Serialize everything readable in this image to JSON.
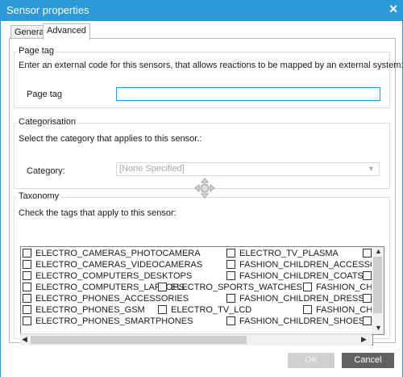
{
  "window": {
    "title": "Sensor properties"
  },
  "tabs": [
    {
      "label": "General"
    },
    {
      "label": "Advanced"
    }
  ],
  "page_tag": {
    "legend": "Page tag",
    "description": "Enter an external code for this sensors, that allows reactions to be mapped by an external system:",
    "label": "Page tag",
    "value": ""
  },
  "categorisation": {
    "legend": "Categorisation",
    "description": "Select the category that applies to this sensor.:",
    "label": "Category:",
    "selected": "[None Specified]"
  },
  "taxonomy": {
    "legend": "Taxonomy",
    "description": "Check the tags that apply to this sensor:",
    "tags": {
      "c1": [
        "ELECTRO_CAMERAS_PHOTOCAMERA",
        "ELECTRO_CAMERAS_VIDEOCAMERAS",
        "ELECTRO_COMPUTERS_DESKTOPS",
        "ELECTRO_COMPUTERS_LAPTOPS",
        "ELECTRO_PHONES_ACCESSORIES",
        "ELECTRO_PHONES_GSM",
        "ELECTRO_PHONES_SMARTPHONES"
      ],
      "c2": [
        "ELECTRO_TV_PLASMA",
        "FASHION_CHILDREN_ACCESSORIES",
        "FASHION_CHILDREN_COATS",
        "ELECTRO_SPORTS_WATCHES",
        "FASHION_CHILDREN_DRESSES",
        "ELECTRO_TV_LCD",
        "FASHION_CHILDREN_SHOES"
      ],
      "c3": [
        "FASHION_CHILD"
      ]
    }
  },
  "buttons": {
    "ok": "OK",
    "cancel": "Cancel"
  }
}
